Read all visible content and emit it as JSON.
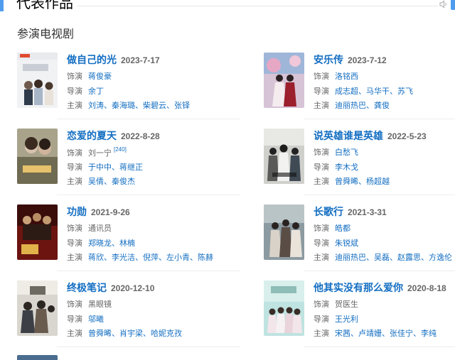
{
  "header": {
    "title": "代表作品"
  },
  "section": {
    "title": "参演电视剧"
  },
  "labels": {
    "role": "饰演",
    "director": "导演",
    "stars": "主演"
  },
  "works": [
    {
      "title": "做自己的光",
      "date": "2023-7-17",
      "role": "蒋俊豪",
      "director": "余丁",
      "stars": "刘涛、秦海璐、柴碧云、张铎"
    },
    {
      "title": "安乐传",
      "date": "2023-7-12",
      "role": "洛铭西",
      "director": "成志超、马华干、苏飞",
      "stars": "迪丽热巴、龚俊"
    },
    {
      "title": "恋爱的夏天",
      "date": "2022-8-28",
      "role": "刘一宁",
      "role_note": "[240]",
      "director": "于中中、蒋继正",
      "stars": "吴倩、秦俊杰"
    },
    {
      "title": "说英雄谁是英雄",
      "date": "2022-5-23",
      "role": "白愁飞",
      "director": "李木戈",
      "stars": "曾舜晞、杨超越"
    },
    {
      "title": "功勋",
      "date": "2021-9-26",
      "role": "通讯员",
      "director": "郑晓龙、林楠",
      "stars": "蒋欣、李光洁、倪萍、左小青、陈赫"
    },
    {
      "title": "长歌行",
      "date": "2021-3-31",
      "role": "皓都",
      "director": "朱锐斌",
      "stars": "迪丽热巴、吴磊、赵露思、方逸伦"
    },
    {
      "title": "终极笔记",
      "date": "2020-12-10",
      "role": "黑眼镜",
      "director": "邬曦",
      "stars": "曾舜晞、肖宇梁、哈妮克孜"
    },
    {
      "title": "他其实没有那么爱你",
      "date": "2020-8-18",
      "role": "贺医生",
      "director": "王光利",
      "stars": "宋茜、卢靖姗、张佳宁、李纯"
    }
  ],
  "colors": {
    "accent": "#4f9cee",
    "link": "#136ec2"
  }
}
